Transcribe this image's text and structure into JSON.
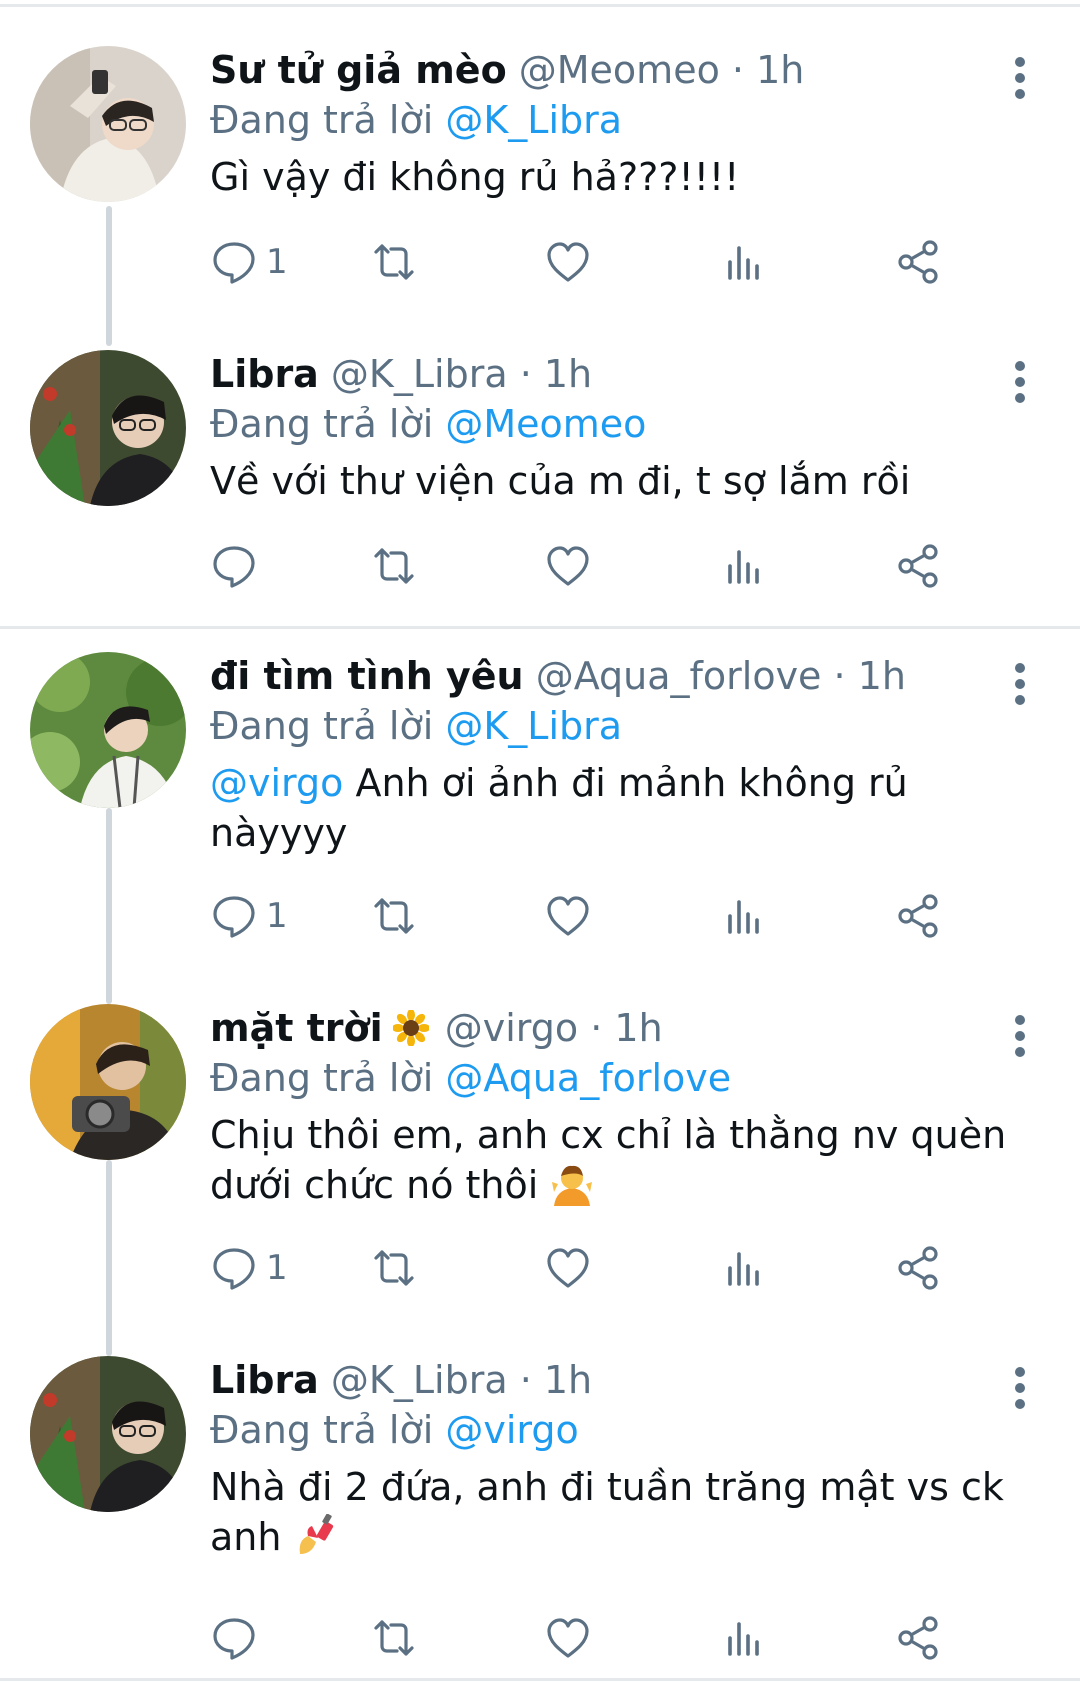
{
  "replying_label": "Đang trả lời",
  "colors": {
    "text": "#0f1419",
    "secondary": "#5b7083",
    "link": "#1d9bf0",
    "divider": "#e6e9ec",
    "thread_line": "#cfd6dc"
  },
  "tweets": [
    {
      "name": "Sư tử giả mèo",
      "handle": "@Meomeo",
      "time": "1h",
      "replying_to": "@K_Libra",
      "text": "Gì vậy đi không rủ hả???!!!!",
      "reply_count": "1",
      "avatar_icon": "avatar-photo"
    },
    {
      "name": "Libra",
      "handle": "@K_Libra",
      "time": "1h",
      "replying_to": "@Meomeo",
      "text": "Về với thư viện của m đi, t sợ lắm rồi",
      "reply_count": "",
      "avatar_icon": "avatar-photo"
    },
    {
      "name": "đi tìm tình yêu",
      "handle": "@Aqua_forlove",
      "time": "1h",
      "replying_to": "@K_Libra",
      "text_mention": "@virgo",
      "text": " Anh ơi ảnh đi mảnh không rủ nàyyyy",
      "reply_count": "1",
      "avatar_icon": "avatar-photo"
    },
    {
      "name": "mặt trời",
      "name_emoji": "sunflower-emoji",
      "handle": "@virgo",
      "time": "1h",
      "replying_to": "@Aqua_forlove",
      "text": "Chịu thôi em, anh cx chỉ là thằng nv quèn dưới chức nó thôi",
      "text_emoji": "person-shrugging-emoji",
      "reply_count": "1",
      "avatar_icon": "avatar-photo"
    },
    {
      "name": "Libra",
      "handle": "@K_Libra",
      "time": "1h",
      "replying_to": "@virgo",
      "text": "Nhà đi 2 đứa, anh đi tuần trăng mật vs ck anh",
      "text_emoji": "nail-polish-emoji",
      "reply_count": "",
      "avatar_icon": "avatar-photo"
    }
  ]
}
